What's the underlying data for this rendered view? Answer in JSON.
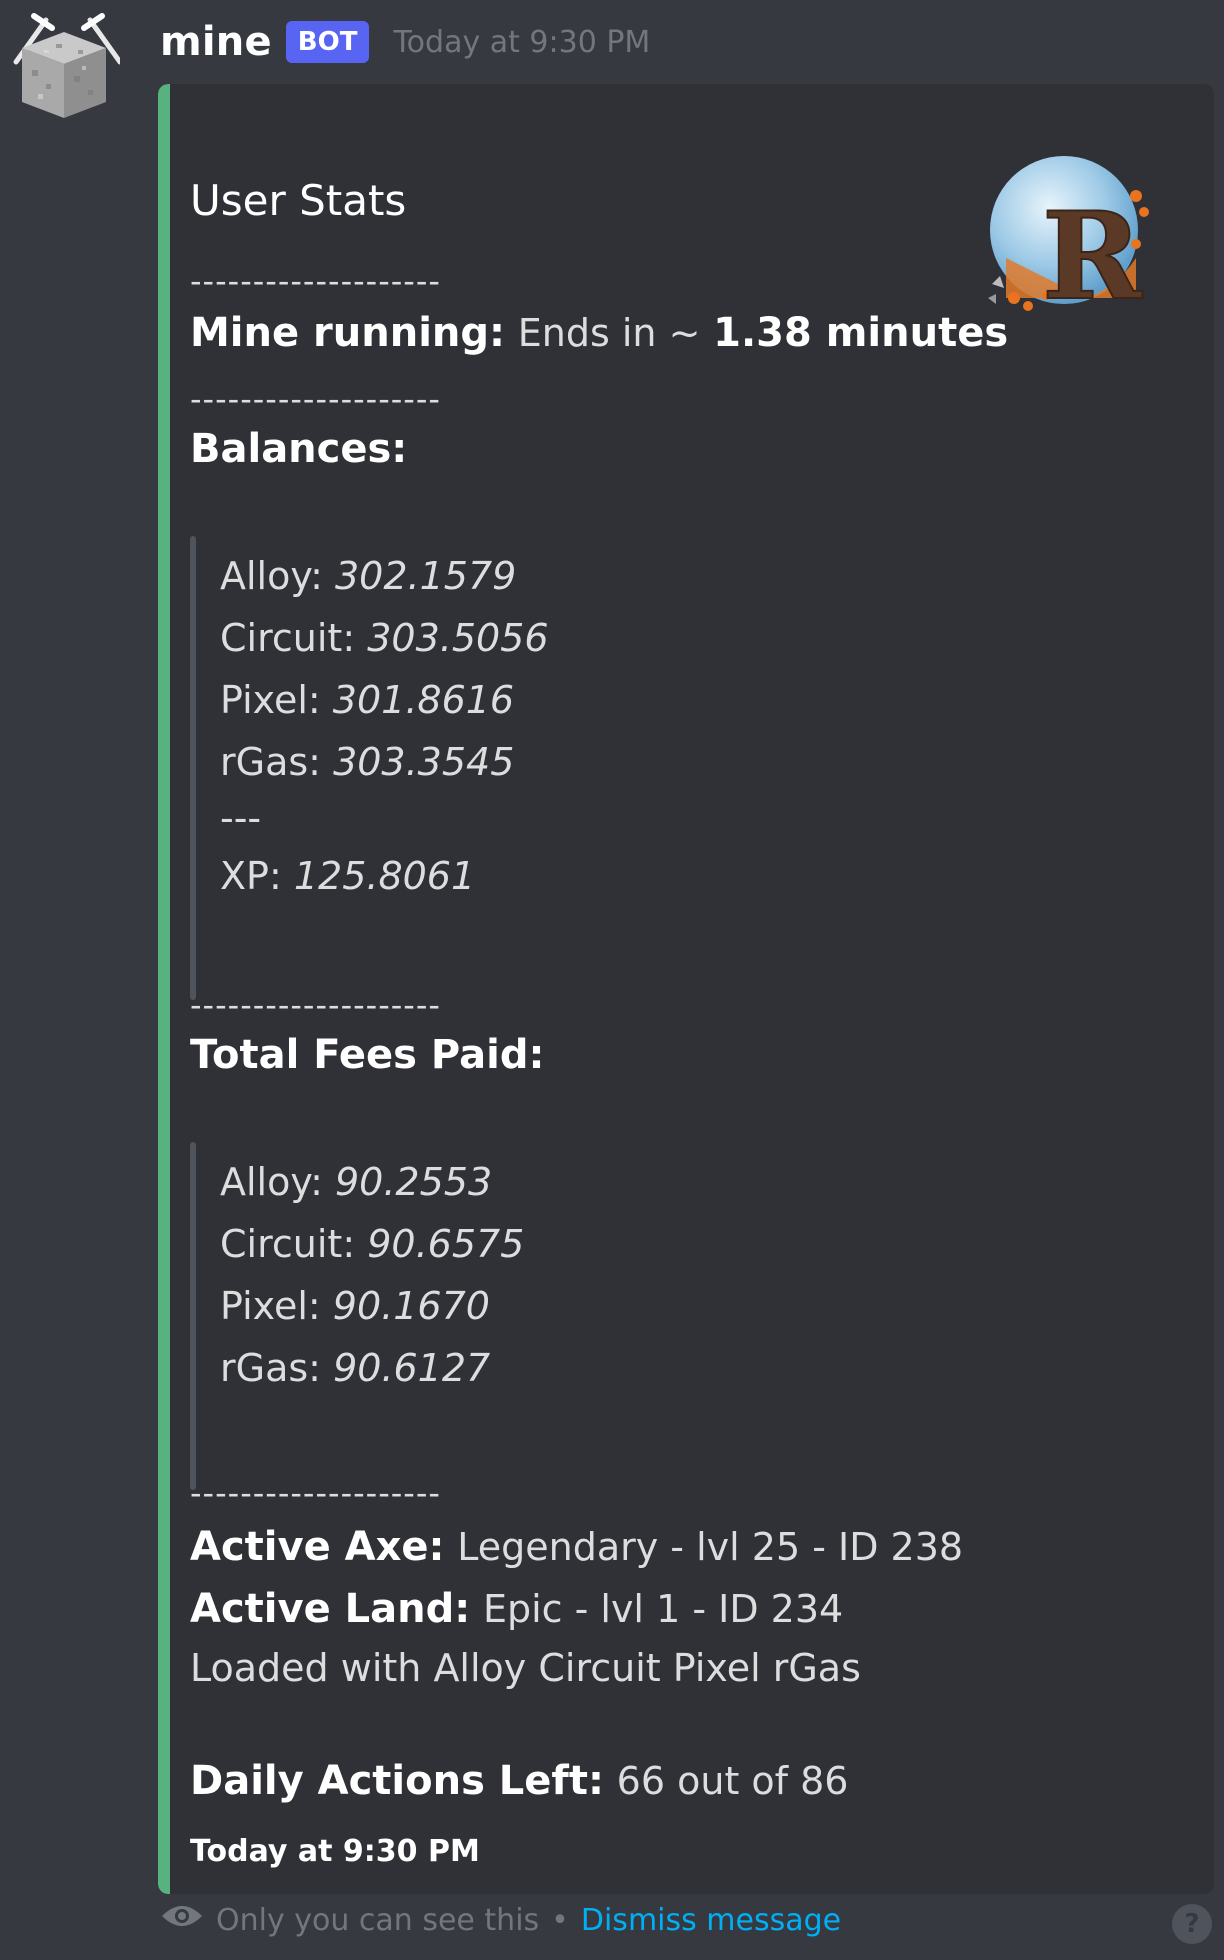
{
  "message": {
    "username": "mine",
    "badge": "BOT",
    "timestamp": "Today at 9:30 PM"
  },
  "embed": {
    "accent_color": "#57b27f",
    "title": "User Stats",
    "divider": "--------------------",
    "mine_running_label": "Mine running:",
    "mine_running_prefix": "Ends in ~",
    "mine_running_value": "1.38 minutes",
    "balances_label": "Balances:",
    "balances": [
      {
        "label": "Alloy:",
        "value": "302.1579"
      },
      {
        "label": "Circuit:",
        "value": "303.5056"
      },
      {
        "label": "Pixel:",
        "value": "301.8616"
      },
      {
        "label": "rGas:",
        "value": "303.3545"
      }
    ],
    "balances_separator": "---",
    "xp": {
      "label": "XP:",
      "value": "125.8061"
    },
    "fees_label": "Total Fees Paid:",
    "fees": [
      {
        "label": "Alloy:",
        "value": "90.2553"
      },
      {
        "label": "Circuit:",
        "value": "90.6575"
      },
      {
        "label": "Pixel:",
        "value": "90.1670"
      },
      {
        "label": "rGas:",
        "value": "90.6127"
      }
    ],
    "active_axe_label": "Active Axe:",
    "active_axe_value": "Legendary - lvl 25 - ID 238",
    "active_land_label": "Active Land:",
    "active_land_value": "Epic - lvl 1 - ID 234",
    "loaded_with": "Loaded with Alloy Circuit Pixel rGas",
    "daily_actions_label": "Daily Actions Left:",
    "daily_actions_value": "66 out of 86",
    "footer_timestamp": "Today at 9:30 PM"
  },
  "ephemeral": {
    "notice": "Only you can see this",
    "separator": "•",
    "dismiss": "Dismiss message",
    "help": "?"
  }
}
